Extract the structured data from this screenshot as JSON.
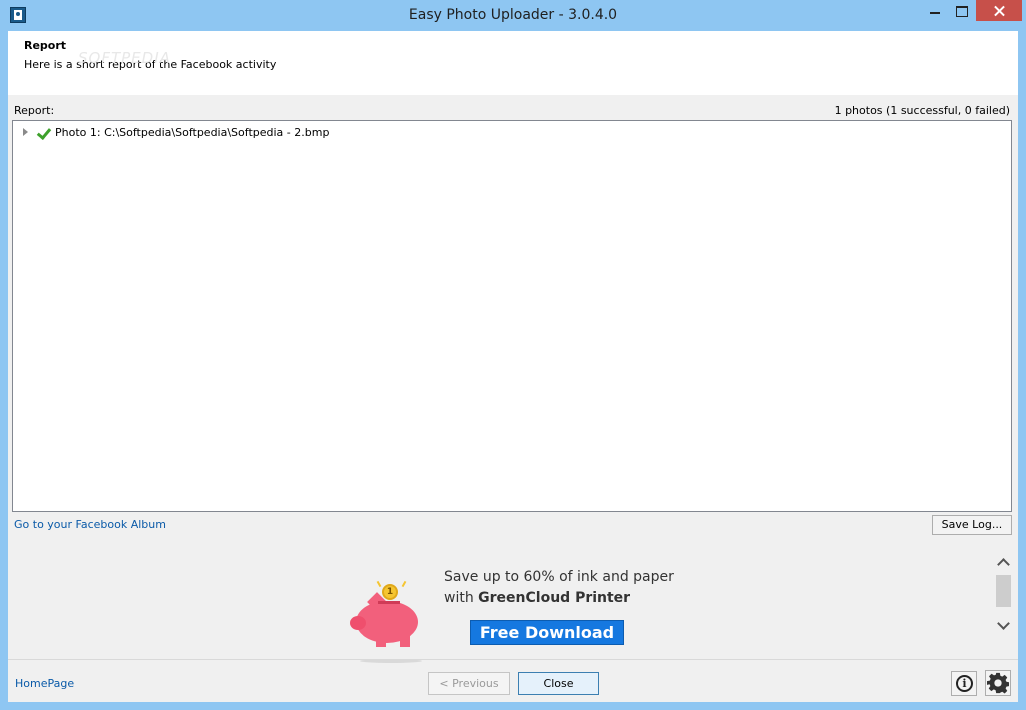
{
  "window": {
    "title": "Easy Photo Uploader - 3.0.4.0"
  },
  "header": {
    "title": "Report",
    "subtitle": "Here is a short report of the Facebook activity",
    "watermark": "SOFTPEDIA"
  },
  "report": {
    "label": "Report:",
    "summary": "1 photos (1 successful, 0 failed)",
    "items": [
      {
        "label": "Photo 1: C:\\Softpedia\\Softpedia\\Softpedia - 2.bmp",
        "status": "success"
      }
    ]
  },
  "links": {
    "facebook_album": "Go to your Facebook Album",
    "homepage": "HomePage"
  },
  "buttons": {
    "save_log": "Save Log...",
    "previous": "< Previous",
    "close": "Close"
  },
  "ad": {
    "line1": "Save up to 60% of ink and paper",
    "line2_prefix": "with ",
    "line2_brand": "GreenCloud Printer",
    "button": "Free Download",
    "coin": "1"
  },
  "icons": {
    "info": "i"
  },
  "colors": {
    "titlebar": "#8ec6f2",
    "close_button": "#c7504a",
    "link": "#0a5aa8",
    "ad_button": "#1578e0",
    "pig": "#f2607c",
    "check": "#3ea12b"
  }
}
